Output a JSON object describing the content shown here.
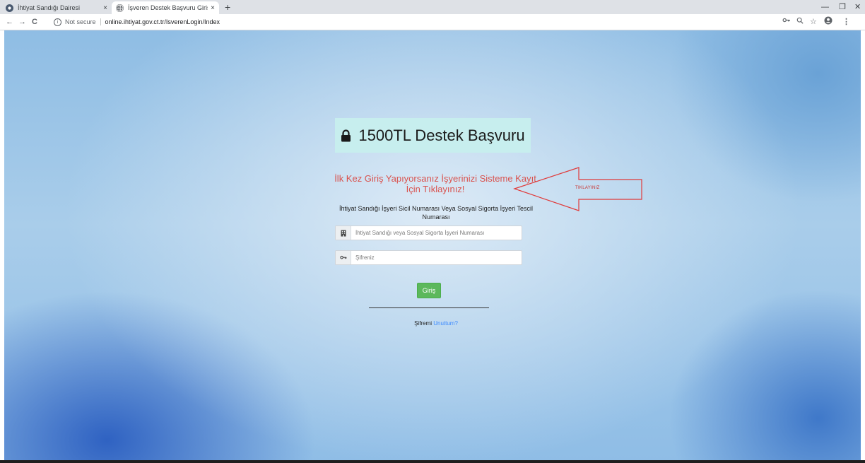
{
  "browser": {
    "tabs": [
      {
        "title": "İhtiyat Sandığı Dairesi",
        "active": false
      },
      {
        "title": "İşveren Destek Başvuru Giriş",
        "active": true
      }
    ],
    "new_tab_symbol": "+",
    "close_symbol": "×",
    "window_controls": {
      "minimize": "—",
      "restore": "❐",
      "close": "✕"
    },
    "nav": {
      "back": "←",
      "forward": "→",
      "reload": "C"
    },
    "security_label": "Not secure",
    "url": "online.ihtiyat.gov.ct.tr/IsverenLogin/Index",
    "toolbar_icons": [
      "key-icon",
      "zoom-icon",
      "star-icon",
      "account-icon",
      "menu-icon"
    ]
  },
  "login": {
    "header_title": "1500TL Destek Başvuru",
    "register_link": "İlk Kez Giriş Yapıyorsanız İşyerinizi Sisteme Kayıt İçin Tıklayınız!",
    "arrow_annotation": "TIKLAYINIZ",
    "field_label": "İhtiyat Sandığı İşyeri Sicil Numarası Veya Sosyal Sigorta İşyeri Tescil Numarası",
    "id_placeholder": "İhtiyat Sandığı veya Sosyal Sigorta İşyeri Numarası",
    "password_placeholder": "Şifreniz",
    "login_button": "Giriş",
    "forgot_prefix": "Şifremi",
    "forgot_link": "Unuttum?"
  },
  "colors": {
    "header_bg": "#c7eeee",
    "link_red": "#d9534f",
    "button_green": "#5cb85c",
    "forgot_link_blue": "#3d8bff"
  }
}
